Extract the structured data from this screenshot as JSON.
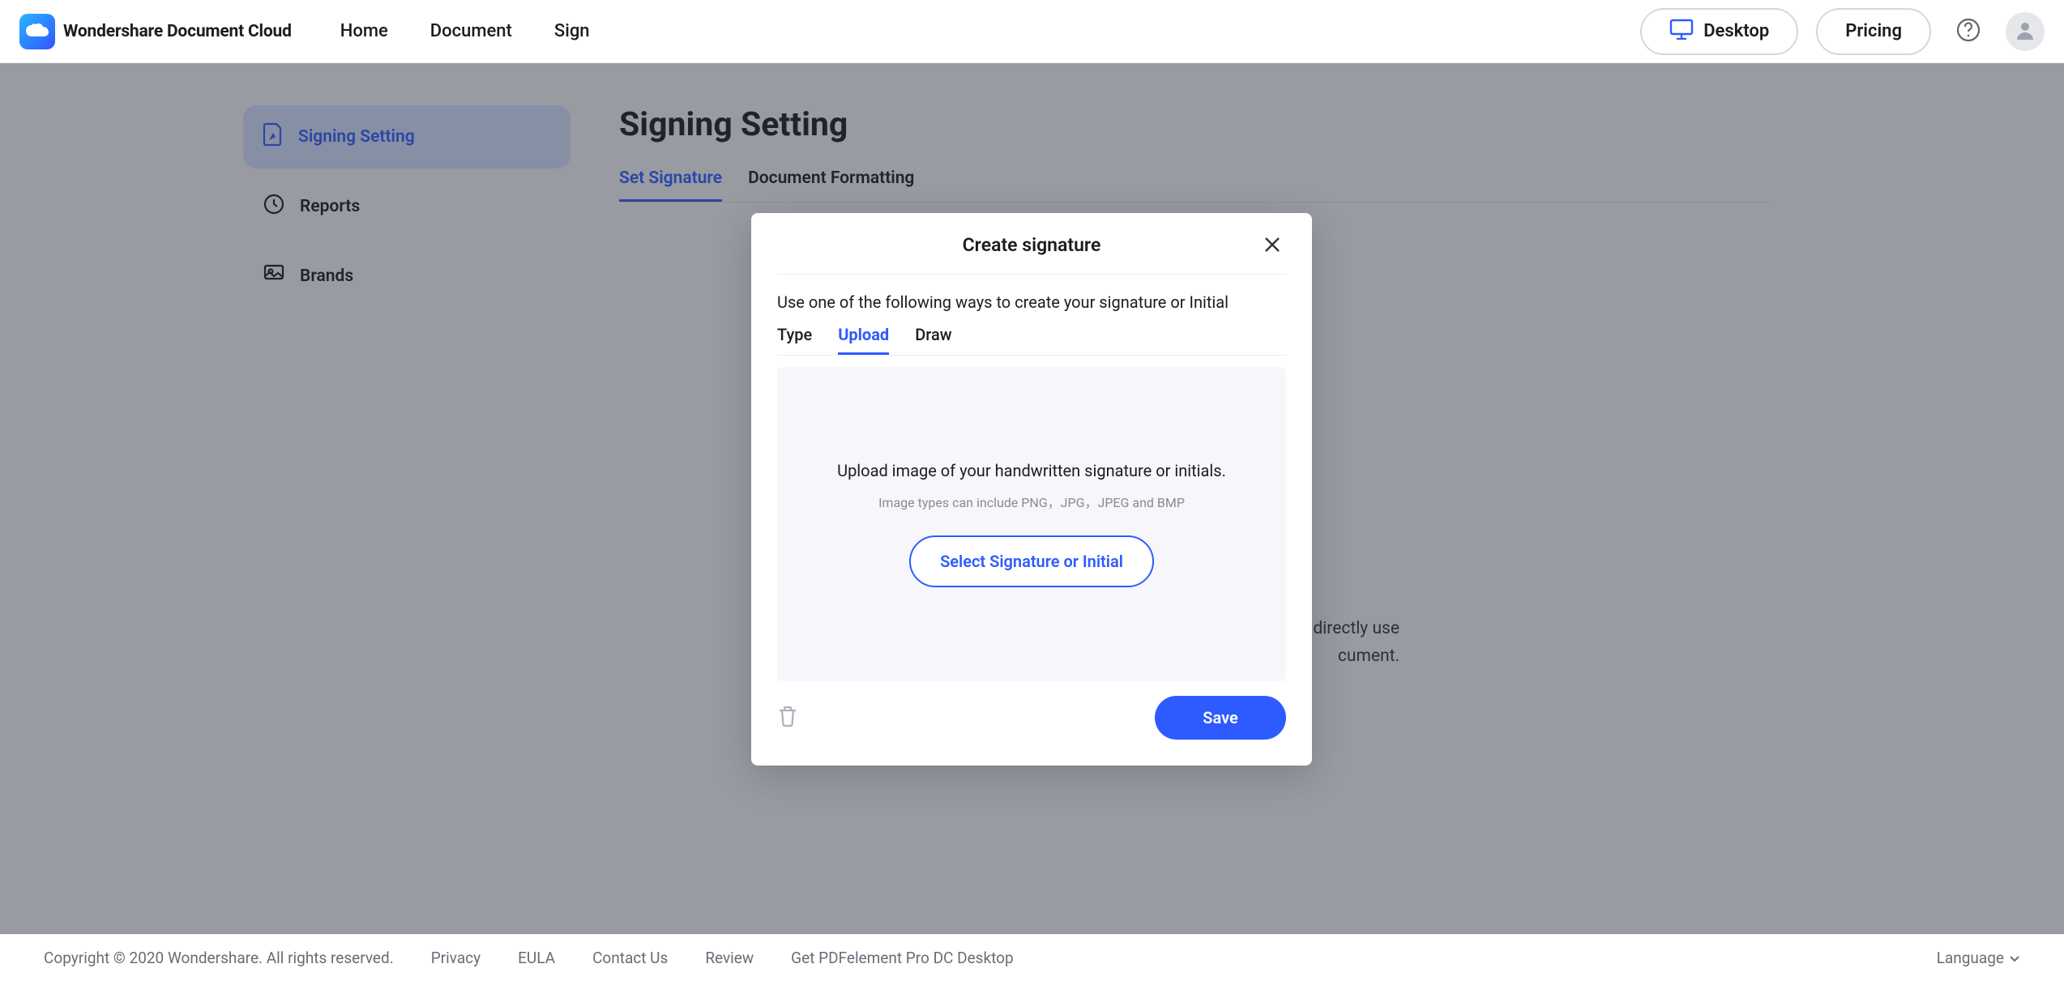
{
  "brand": {
    "name": "Wondershare Document Cloud"
  },
  "nav": {
    "home": "Home",
    "document": "Document",
    "sign": "Sign"
  },
  "header_actions": {
    "desktop": "Desktop",
    "pricing": "Pricing"
  },
  "sidebar": {
    "signing_setting": "Signing Setting",
    "reports": "Reports",
    "brands": "Brands"
  },
  "page": {
    "title": "Signing Setting",
    "tab_set_signature": "Set Signature",
    "tab_document_formatting": "Document Formatting",
    "background_hint_line1": "directly use",
    "background_hint_line2": "cument."
  },
  "modal": {
    "title": "Create signature",
    "subtitle": "Use one of the following ways to create your signature or Initial",
    "tab_type": "Type",
    "tab_upload": "Upload",
    "tab_draw": "Draw",
    "upload_main": "Upload image of your handwritten signature or initials.",
    "upload_hint": "Image types can include PNG，JPG，JPEG and BMP",
    "select_button": "Select Signature or Initial",
    "save": "Save"
  },
  "footer": {
    "copyright": "Copyright © 2020 Wondershare. All rights reserved.",
    "privacy": "Privacy",
    "eula": "EULA",
    "contact": "Contact Us",
    "review": "Review",
    "get_desktop": "Get PDFelement Pro DC Desktop",
    "language": "Language"
  },
  "colors": {
    "accent": "#2e5bff"
  }
}
